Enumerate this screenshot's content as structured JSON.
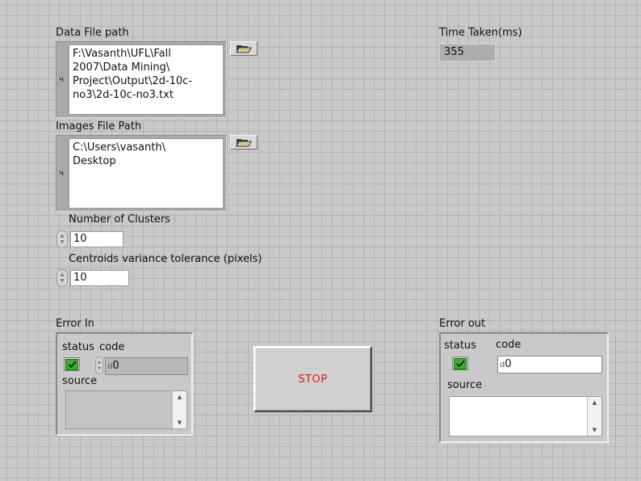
{
  "data_file_path": {
    "label": "Data File path",
    "value": "F:\\Vasanth\\UFL\\Fall\n2007\\Data Mining\\\nProject\\Output\\2d-10c-\nno3\\2d-10c-no3.txt"
  },
  "images_file_path": {
    "label": "Images File Path",
    "value": "C:\\Users\\vasanth\\\nDesktop"
  },
  "time_taken": {
    "label": "Time Taken(ms)",
    "value": "355"
  },
  "number_of_clusters": {
    "label": "Number of Clusters",
    "value": "10"
  },
  "centroids_tolerance": {
    "label": "Centroids variance tolerance (pixels)",
    "value": "10"
  },
  "error_in": {
    "label": "Error In",
    "status_label": "status",
    "code_label": "code",
    "code_prefix": "d",
    "code_value": "0",
    "source_label": "source",
    "source_value": ""
  },
  "stop_button": {
    "label": "STOP"
  },
  "error_out": {
    "label": "Error out",
    "status_label": "status",
    "code_label": "code",
    "code_prefix": "d",
    "code_value": "0",
    "source_label": "source",
    "source_value": ""
  },
  "colors": {
    "panel_background": "#c9c9c9",
    "grid_line": "#b3b3b3",
    "status_ok": "#3fae2f",
    "stop_text": "#e21d1d"
  },
  "icons": {
    "path_type": "path-glyph-icon",
    "browse": "folder-open-icon",
    "status_ok": "checkmark-icon",
    "spin": "increment-decrement-icon"
  }
}
